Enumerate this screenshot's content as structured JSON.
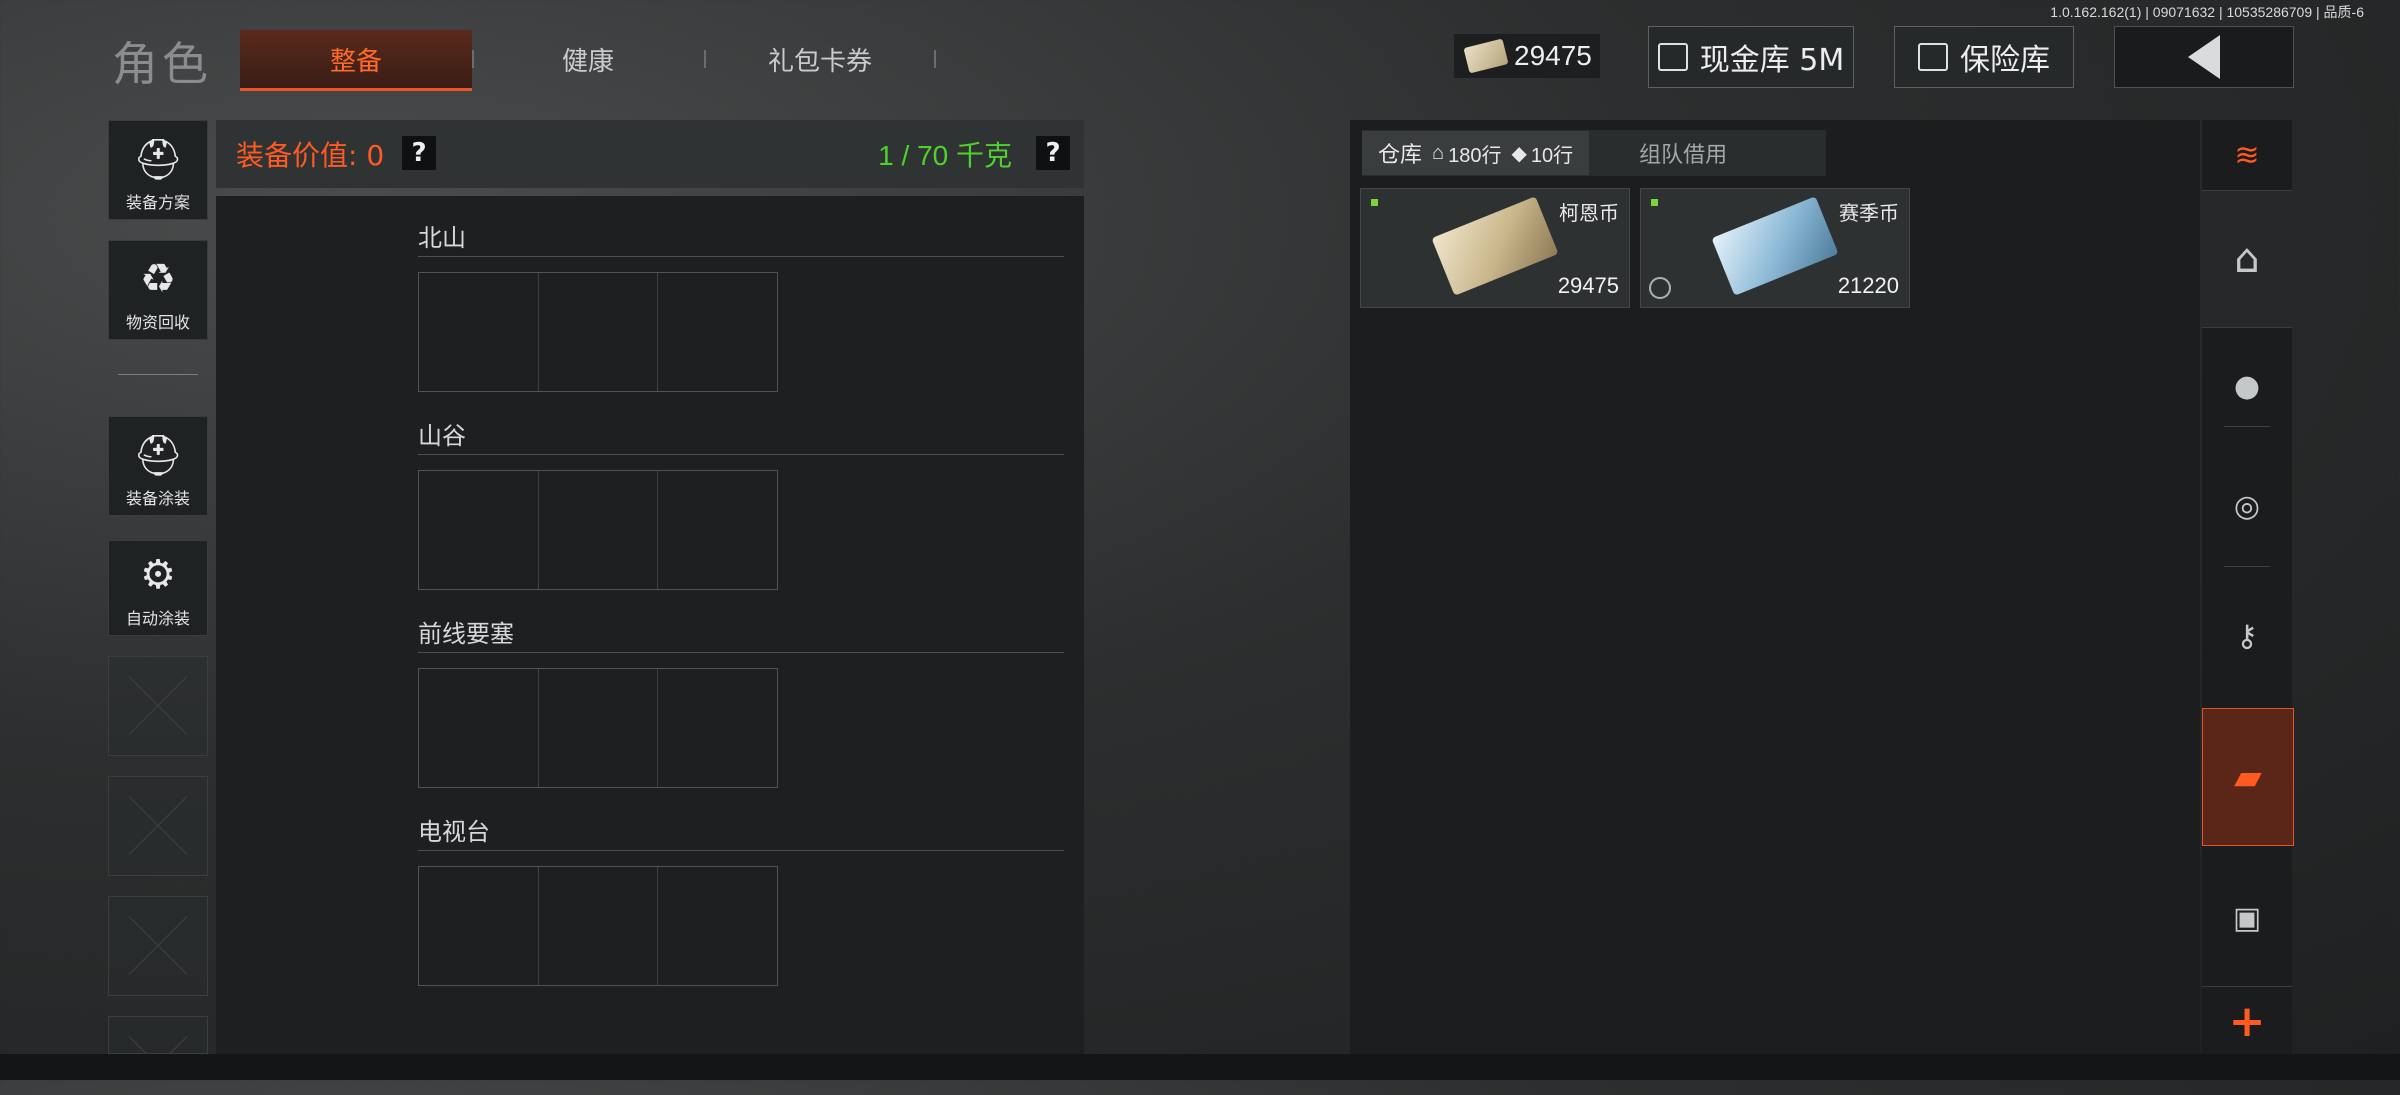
{
  "build_info": "1.0.162.162(1) | 09071632 | 10535286709 | 品质-6",
  "page_title": "角色",
  "tabs": [
    {
      "label": "整备",
      "active": true
    },
    {
      "label": "健康",
      "active": false
    },
    {
      "label": "礼包卡券",
      "active": false
    }
  ],
  "currency": {
    "amount": "29475",
    "icon": "cash-bundle-icon"
  },
  "top_buttons": {
    "cash_vault": "现金库 5M",
    "safe_box": "保险库"
  },
  "left_rail": [
    {
      "label": "装备方案",
      "icon": "helmet-loadout-icon"
    },
    {
      "label": "物资回收",
      "icon": "recycle-icon"
    },
    {
      "label": "装备涂装",
      "icon": "paint-helmet-icon"
    },
    {
      "label": "自动涂装",
      "icon": "auto-paint-icon"
    }
  ],
  "equipment": {
    "value_label": "装备价值: 0",
    "help": "?",
    "weight": "1 / 70 千克",
    "sections": [
      "北山",
      "山谷",
      "前线要塞",
      "电视台"
    ]
  },
  "stash": {
    "tab_label": "仓库",
    "rows_home": "180行",
    "rows_ticket": "10行",
    "borrow_label": "组队借用",
    "items": [
      {
        "name": "柯恩币",
        "count": "29475",
        "color": "#c9b58a"
      },
      {
        "name": "赛季币",
        "count": "21220",
        "color": "#8ab8d6"
      }
    ]
  },
  "right_rail": [
    "stack-refresh-icon",
    "home-icon",
    "grenade-icon",
    "coins-icon",
    "key-icon",
    "money-icon",
    "box-icon",
    "plus-icon"
  ],
  "colors": {
    "accent": "#ff5a22",
    "weight_green": "#4fd12c",
    "dot_green": "#7fd23b"
  }
}
